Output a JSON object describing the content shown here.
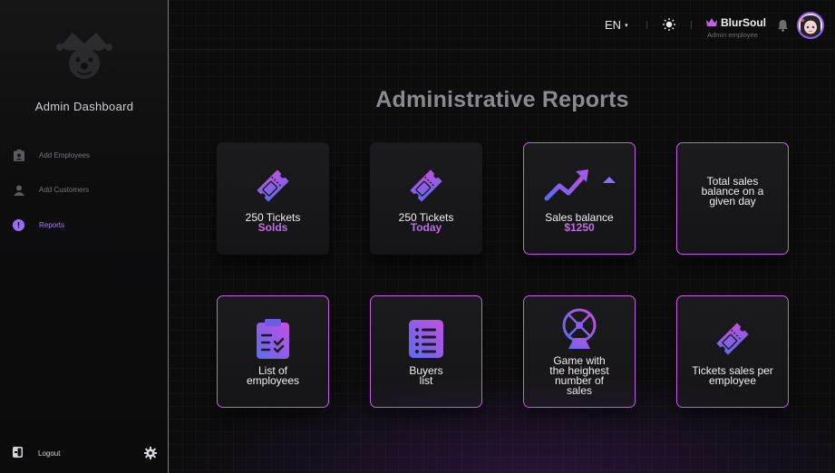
{
  "sidebar": {
    "brand": "Admin Dashboard",
    "items": [
      {
        "label": "Add Employees",
        "icon": "clipboard-user-icon",
        "active": false
      },
      {
        "label": "Add Customers",
        "icon": "user-icon",
        "active": false
      },
      {
        "label": "Reports",
        "icon": "alert-circle-icon",
        "active": true
      }
    ],
    "logout_label": "Logout"
  },
  "topbar": {
    "language": "EN",
    "user_name": "BlurSoul",
    "user_role": "Admin employee"
  },
  "page": {
    "title": "Administrative Reports"
  },
  "cards": [
    {
      "line1": "250 Tickets",
      "line2": "Solds",
      "icon": "ticket-icon"
    },
    {
      "line1": "250 Tickets",
      "line2": "Today",
      "icon": "ticket-icon"
    },
    {
      "line1": "Sales balance",
      "line2": "$1250",
      "icon": "trending-up-icon"
    },
    {
      "line1": "Total sales balance on a given day",
      "icon": "none"
    },
    {
      "line1": "List of employees",
      "icon": "clipboard-check-icon"
    },
    {
      "line1": "Buyers list",
      "icon": "list-icon"
    },
    {
      "line1": "Game with the heighest number of sales",
      "icon": "ferris-wheel-icon"
    },
    {
      "line1": "Tickets sales per employee",
      "icon": "ticket-icon"
    }
  ],
  "colors": {
    "accent": "#8a5cf6",
    "highlight": "#c06be6",
    "background": "#0c0c0d"
  }
}
